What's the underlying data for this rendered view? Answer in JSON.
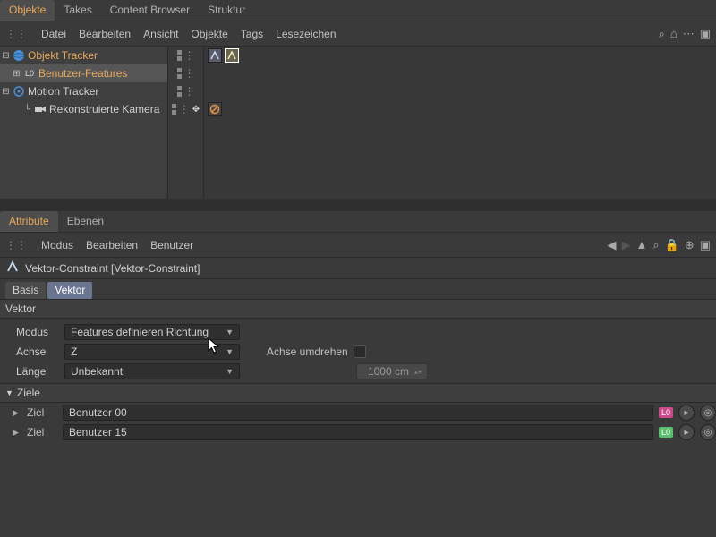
{
  "top_tabs": {
    "objekte": "Objekte",
    "takes": "Takes",
    "content_browser": "Content Browser",
    "struktur": "Struktur"
  },
  "menubar": {
    "datei": "Datei",
    "bearbeiten": "Bearbeiten",
    "ansicht": "Ansicht",
    "objekte": "Objekte",
    "tags": "Tags",
    "lesezeichen": "Lesezeichen"
  },
  "tree": {
    "objekt_tracker": "Objekt Tracker",
    "benutzer_features": "Benutzer-Features",
    "motion_tracker": "Motion Tracker",
    "rekon_kamera": "Rekonstruierte Kamera"
  },
  "attr_tabs": {
    "attribute": "Attribute",
    "ebenen": "Ebenen"
  },
  "attr_menu": {
    "modus": "Modus",
    "bearbeiten": "Bearbeiten",
    "benutzer": "Benutzer"
  },
  "attr_header": "Vektor-Constraint [Vektor-Constraint]",
  "subtabs": {
    "basis": "Basis",
    "vektor": "Vektor"
  },
  "section_vektor": "Vektor",
  "section_ziele": "Ziele",
  "form": {
    "modus_label": "Modus",
    "modus_value": "Features definieren Richtung",
    "achse_label": "Achse",
    "achse_value": "Z",
    "achse_umdrehen_label": "Achse umdrehen",
    "laenge_label": "Länge",
    "laenge_value": "Unbekannt",
    "laenge_num": "1000 cm"
  },
  "targets": {
    "ziel_label": "Ziel",
    "t0": "Benutzer 00",
    "t1": "Benutzer 15"
  },
  "colors": {
    "badge0": "#c94b8a",
    "badge1": "#5bbf6f"
  }
}
